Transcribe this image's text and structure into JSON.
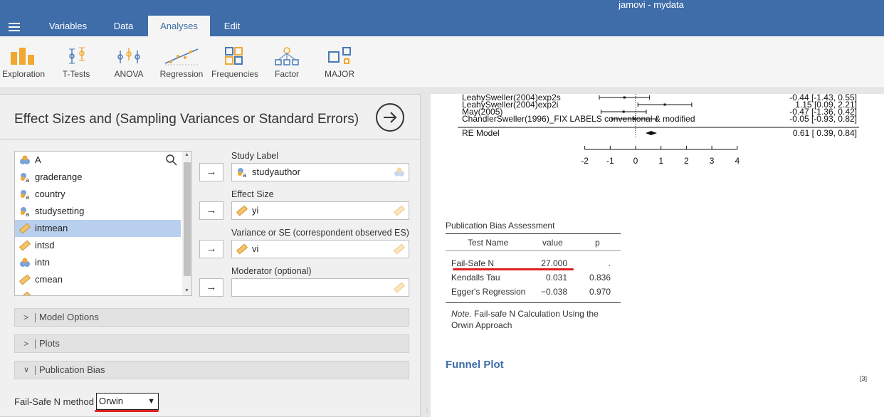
{
  "app": {
    "title": "jamovi - mydata"
  },
  "tabs": [
    {
      "label": "Variables",
      "active": false
    },
    {
      "label": "Data",
      "active": false
    },
    {
      "label": "Analyses",
      "active": true
    },
    {
      "label": "Edit",
      "active": false
    }
  ],
  "ribbon": {
    "items": [
      {
        "label": "Exploration",
        "icon": "exploration-icon"
      },
      {
        "label": "T-Tests",
        "icon": "ttests-icon"
      },
      {
        "label": "ANOVA",
        "icon": "anova-icon"
      },
      {
        "label": "Regression",
        "icon": "regression-icon"
      },
      {
        "label": "Frequencies",
        "icon": "frequencies-icon"
      },
      {
        "label": "Factor",
        "icon": "factor-icon"
      },
      {
        "label": "MAJOR",
        "icon": "major-icon"
      }
    ]
  },
  "options": {
    "title": "Effect Sizes and (Sampling Variances or Standard Errors)",
    "variables": [
      {
        "name": "A",
        "type": "nominal",
        "selected": false
      },
      {
        "name": "graderange",
        "type": "nominal-text",
        "selected": false
      },
      {
        "name": "country",
        "type": "nominal-text",
        "selected": false
      },
      {
        "name": "studysetting",
        "type": "nominal-text",
        "selected": false
      },
      {
        "name": "intmean",
        "type": "continuous",
        "selected": true
      },
      {
        "name": "intsd",
        "type": "continuous",
        "selected": false
      },
      {
        "name": "intn",
        "type": "nominal",
        "selected": false
      },
      {
        "name": "cmean",
        "type": "continuous",
        "selected": false
      }
    ],
    "targets": [
      {
        "label": "Study Label",
        "value": "studyauthor",
        "type": "nominal-text"
      },
      {
        "label": "Effect Size",
        "value": "yi",
        "type": "continuous"
      },
      {
        "label": "Variance or SE (correspondent observed ES)",
        "value": "vi",
        "type": "continuous"
      },
      {
        "label": "Moderator (optional)",
        "value": "",
        "type": "none"
      }
    ],
    "sections": [
      {
        "label": "Model Options",
        "expanded": false
      },
      {
        "label": "Plots",
        "expanded": false
      },
      {
        "label": "Publication Bias",
        "expanded": true
      }
    ],
    "failsafe": {
      "label": "Fail-Safe N method",
      "value": "Orwin"
    }
  },
  "results": {
    "forest": {
      "rows": [
        {
          "label": "LeahySweller(2004)exp2s",
          "ci": "-0.44 [-1.43, 0.55]"
        },
        {
          "label": "LeahySweller(2004)exp2i",
          "ci": "1.15 [0.09, 2.21]"
        },
        {
          "label": "May(2005)",
          "ci": "-0.47 [-1.36, 0.42]"
        },
        {
          "label": "ChandlerSweller(1996)_FIX LABELS conventional & modified",
          "ci": "-0.05 [-0.93, 0.82]"
        }
      ],
      "model": {
        "label": "RE Model",
        "ci": "0.61 [ 0.39, 0.84]"
      },
      "ticks": [
        "-2",
        "-1",
        "0",
        "1",
        "2",
        "3",
        "4"
      ]
    },
    "pba": {
      "title": "Publication Bias Assessment",
      "headers": {
        "test": "Test Name",
        "value": "value",
        "p": "p"
      },
      "rows": [
        {
          "test": "Fail-Safe N",
          "value": "27.000",
          "p": "."
        },
        {
          "test": "Kendalls Tau",
          "value": "0.031",
          "p": "0.836"
        },
        {
          "test": "Egger's Regression",
          "value": "−0.038",
          "p": "0.970"
        }
      ],
      "note_prefix": "Note.",
      "note_text": " Fail-safe N Calculation Using the Orwin Approach"
    },
    "funnel_title": "Funnel Plot",
    "ref": "[3]"
  }
}
